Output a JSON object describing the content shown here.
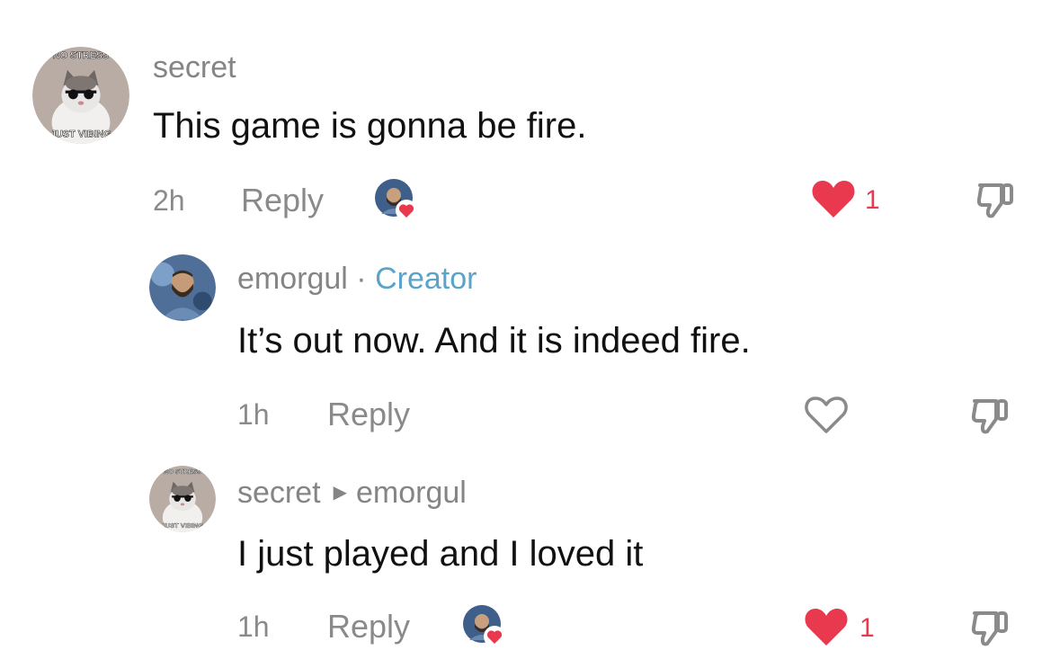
{
  "comments": [
    {
      "username": "secret",
      "badge": "",
      "reply_to": "",
      "text": "This game is gonna be fire.",
      "time": "2h",
      "reply_label": "Reply",
      "liked_by_creator": true,
      "liked": true,
      "like_count": "1",
      "avatar": {
        "icon": "cat-sunglasses-meme",
        "top_text": "NO STRESS",
        "bottom_text": "JUST VIBING"
      }
    },
    {
      "username": "emorgul",
      "badge": "Creator",
      "separator": "·",
      "reply_to": "",
      "text": "It’s out now. And it is indeed fire.",
      "time": "1h",
      "reply_label": "Reply",
      "liked_by_creator": false,
      "liked": false,
      "like_count": "",
      "avatar": {
        "icon": "bearded-man-photo"
      }
    },
    {
      "username": "secret",
      "badge": "",
      "reply_to": "emorgul",
      "text": "I just played and I loved it",
      "time": "1h",
      "reply_label": "Reply",
      "liked_by_creator": true,
      "liked": true,
      "like_count": "1",
      "avatar": {
        "icon": "cat-sunglasses-meme",
        "top_text": "NO STRESS",
        "bottom_text": "JUST VIBING"
      }
    }
  ],
  "colors": {
    "like_red": "#e8394f",
    "creator_blue": "#5aa3c9",
    "meta_gray": "#8a8a8a",
    "text_black": "#111111"
  }
}
